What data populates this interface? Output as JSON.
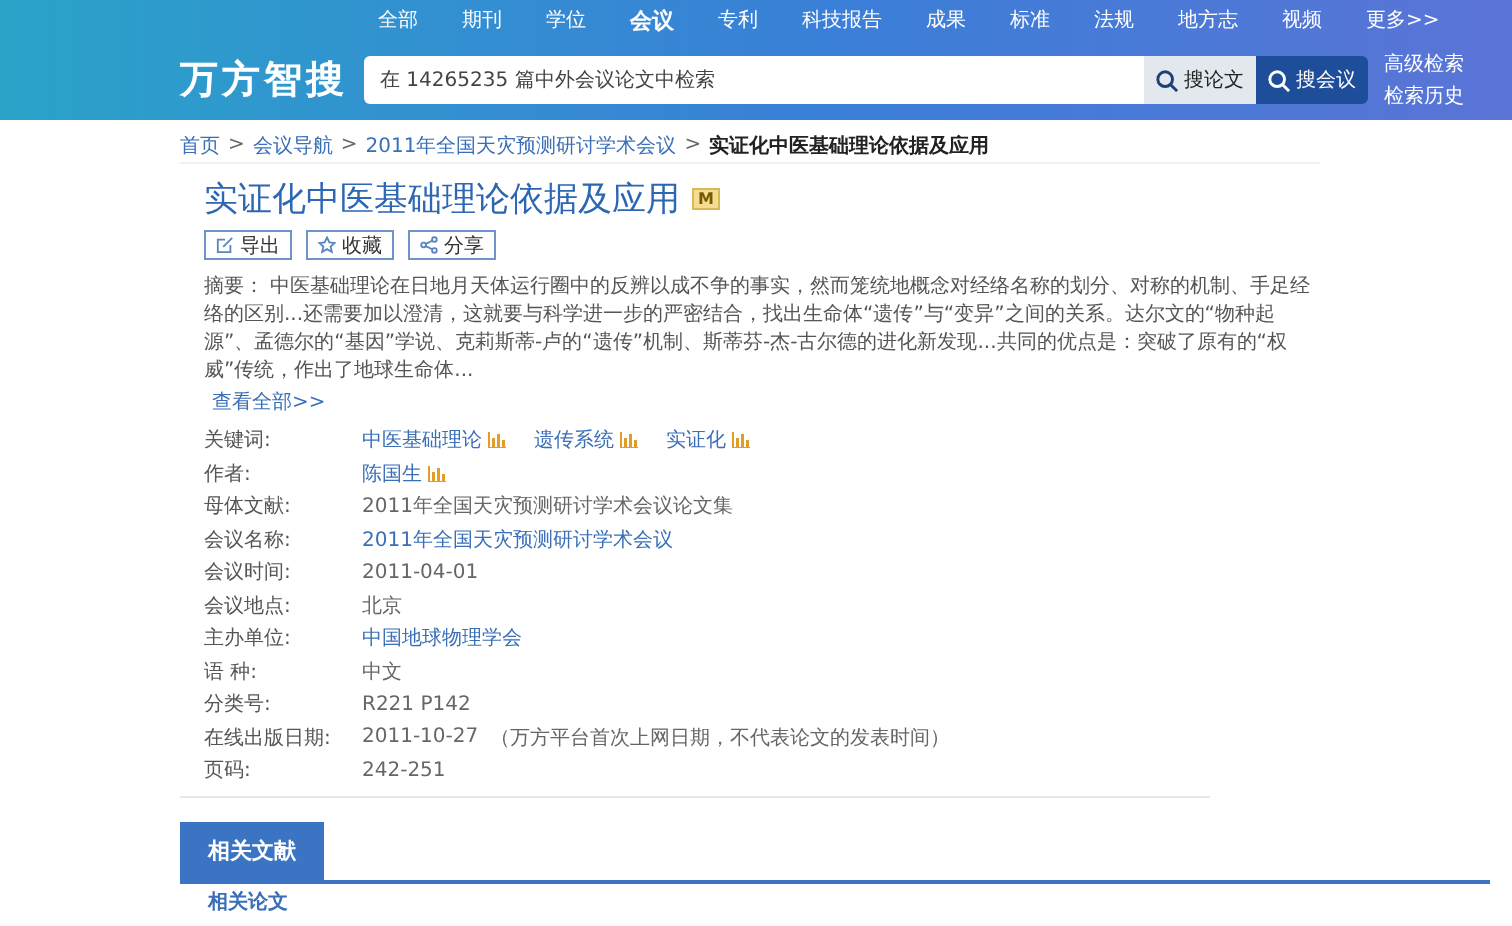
{
  "nav": [
    {
      "label": "全部",
      "selected": false
    },
    {
      "label": "期刊",
      "selected": false
    },
    {
      "label": "学位",
      "selected": false
    },
    {
      "label": "会议",
      "selected": true
    },
    {
      "label": "专利",
      "selected": false
    },
    {
      "label": "科技报告",
      "selected": false
    },
    {
      "label": "成果",
      "selected": false
    },
    {
      "label": "标准",
      "selected": false
    },
    {
      "label": "法规",
      "selected": false
    },
    {
      "label": "地方志",
      "selected": false
    },
    {
      "label": "视频",
      "selected": false
    },
    {
      "label": "更多>>",
      "selected": false
    }
  ],
  "logo": "万方智搜",
  "search": {
    "placeholder": "在 14265235 篇中外会议论文中检索"
  },
  "search_buttons": [
    {
      "label": "搜论文",
      "kind": "light"
    },
    {
      "label": "搜会议",
      "kind": "dark"
    }
  ],
  "side_links": [
    "高级检索",
    "检索历史"
  ],
  "breadcrumb_separator": ">",
  "breadcrumb": [
    {
      "label": "首页",
      "current": false
    },
    {
      "label": "会议导航",
      "current": false
    },
    {
      "label": "2011年全国天灾预测研讨学术会议",
      "current": false
    },
    {
      "label": "实证化中医基础理论依据及应用",
      "current": true
    }
  ],
  "title": "实证化中医基础理论依据及应用",
  "title_badge": "M",
  "actions": [
    {
      "label": "导出",
      "kind": "export"
    },
    {
      "label": "收藏",
      "kind": "star"
    },
    {
      "label": "分享",
      "kind": "share"
    }
  ],
  "abstract": {
    "label": "摘要：",
    "text": "中医基础理论在日地月天体运行圈中的反辨以成不争的事实，然而笼统地概念对经络名称的划分、对称的机制、手足经络的区别...还需要加以澄清，这就要与科学进一步的严密结合，找出生命体“遗传”与“变异”之间的关系。达尔文的“物种起源”、孟德尔的“基因”学说、克莉斯蒂-卢的“遗传”机制、斯蒂芬-杰-古尔德的进化新发现...共同的优点是：突破了原有的“权威”传统，作出了地球生命体...",
    "more": "查看全部>>"
  },
  "fields": [
    {
      "label": "关键词:",
      "kind": "links",
      "items": [
        "中医基础理论",
        "遗传系统",
        "实证化"
      ]
    },
    {
      "label": "作者:",
      "kind": "links",
      "items": [
        "陈国生"
      ]
    },
    {
      "label": "母体文献:",
      "kind": "text",
      "value": "2011年全国天灾预测研讨学术会议论文集"
    },
    {
      "label": "会议名称:",
      "kind": "link",
      "value": "2011年全国天灾预测研讨学术会议"
    },
    {
      "label": "会议时间:",
      "kind": "text",
      "value": "2011-04-01"
    },
    {
      "label": "会议地点:",
      "kind": "text",
      "value": "北京"
    },
    {
      "label": "主办单位:",
      "kind": "link",
      "value": "中国地球物理学会"
    },
    {
      "label": "语 种:",
      "kind": "text",
      "value": "中文"
    },
    {
      "label": "分类号:",
      "kind": "text",
      "value": "R221  P142"
    },
    {
      "label": "在线出版日期:",
      "kind": "text",
      "value": "2011-10-27",
      "note": "（万方平台首次上网日期，不代表论文的发表时间）"
    },
    {
      "label": "页码:",
      "kind": "text",
      "value": "242-251"
    }
  ],
  "related": {
    "tab": "相关文献",
    "heading": "相关论文"
  }
}
